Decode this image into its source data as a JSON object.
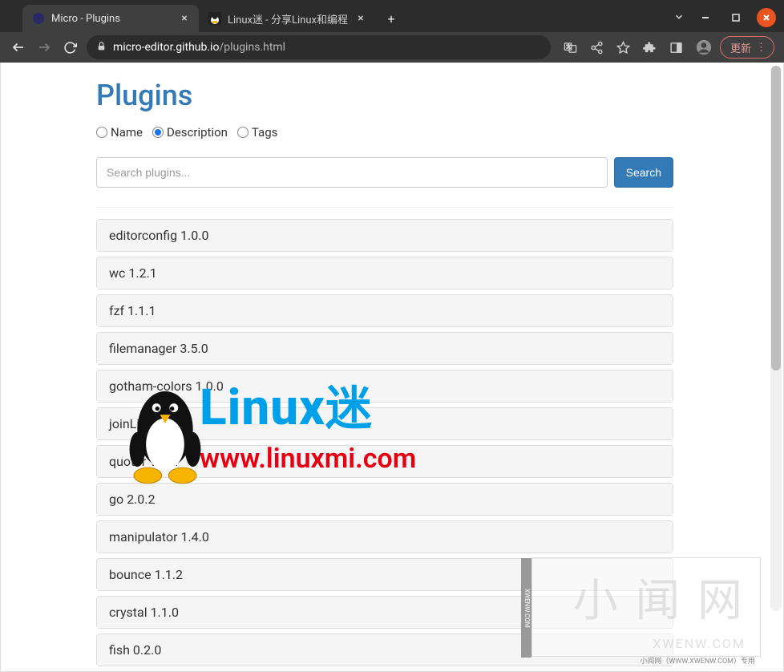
{
  "browser": {
    "tabs": [
      {
        "title": "Micro - Plugins",
        "active": true
      },
      {
        "title": "Linux迷 - 分享Linux和编程",
        "active": false
      }
    ],
    "url_domain": "micro-editor.github.io",
    "url_path": "/plugins.html",
    "update_label": "更新"
  },
  "page": {
    "title": "Plugins",
    "filters": [
      {
        "label": "Name",
        "checked": false
      },
      {
        "label": "Description",
        "checked": true
      },
      {
        "label": "Tags",
        "checked": false
      }
    ],
    "search_placeholder": "Search plugins...",
    "search_btn": "Search",
    "plugins": [
      "editorconfig 1.0.0",
      "wc 1.2.1",
      "fzf 1.1.1",
      "filemanager 3.5.0",
      "gotham-colors 1.0.0",
      "joinLines 1.0.0",
      "quoter 1.0.2",
      "go 2.0.2",
      "manipulator 1.4.0",
      "bounce 1.1.2",
      "crystal 1.1.0",
      "fish 0.2.0"
    ]
  },
  "watermark": {
    "brand_main": "Linux",
    "brand_suffix": "迷",
    "brand_url": "www.linuxmi.com",
    "corner_big": "小 闻 网",
    "corner_sub": "XWENW.COM",
    "corner_note": "小闻网（WWW.XWENW.COM）专用",
    "corner_vert": "XWENW.COM"
  }
}
